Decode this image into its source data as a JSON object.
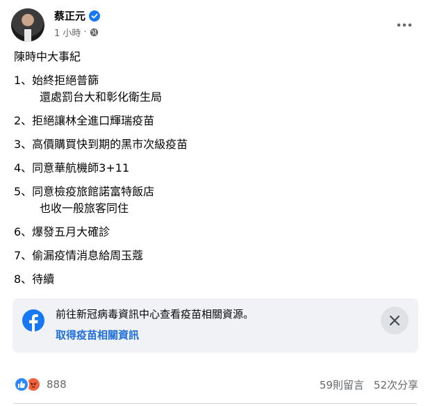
{
  "post_header": {
    "author": "蔡正元",
    "time": "1 小時",
    "separator": "·"
  },
  "post": {
    "title": "陳時中大事紀",
    "items": [
      {
        "line": "1、始終拒絕普篩",
        "sub": "還處罰台大和彰化衛生局"
      },
      {
        "line": "2、拒絕讓林全進口輝瑞疫苗"
      },
      {
        "line": "3、高價購買快到期的黑市次級疫苗"
      },
      {
        "line": "4、同意華航機師3+11"
      },
      {
        "line": "5、同意檢疫旅館諾富特飯店",
        "sub": "也收一般旅客同住"
      },
      {
        "line": "6、爆發五月大確診"
      },
      {
        "line": "7、偷漏疫情消息給周玉蔻"
      },
      {
        "line": "8、待續"
      }
    ]
  },
  "banner": {
    "text": "前往新冠病毒資訊中心查看疫苗相關資源。",
    "link": "取得疫苗相關資訊"
  },
  "footer": {
    "reaction_count": "888",
    "comments": "59則留言",
    "shares": "52次分享"
  },
  "colors": {
    "facebook_blue": "#1877f2",
    "link_blue": "#216fdb",
    "like_blue": "#2d88ff",
    "angry_orange": "#f0623e",
    "banner_bg": "#f0f2f5"
  }
}
